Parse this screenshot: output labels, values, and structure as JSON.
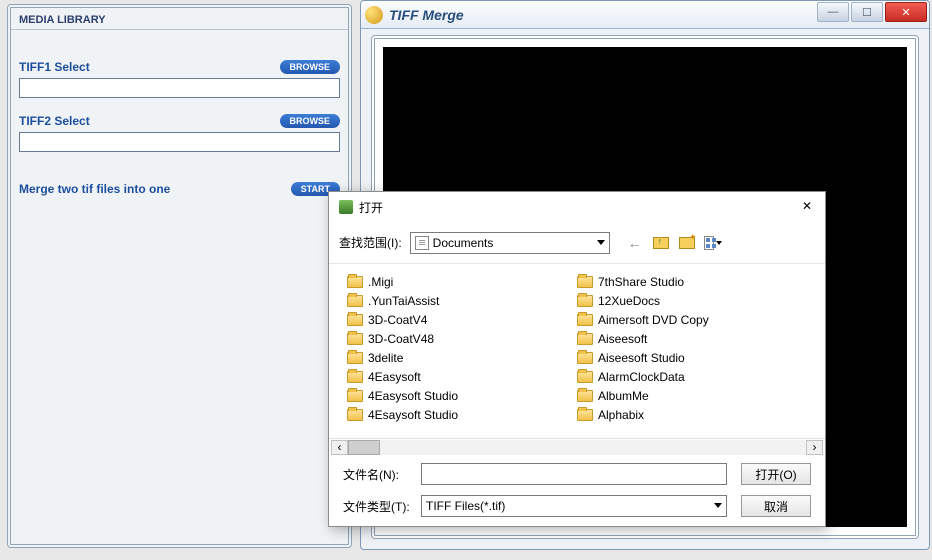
{
  "left": {
    "header": "MEDIA LIBRARY",
    "tiff1_label": "TIFF1 Select",
    "tiff2_label": "TIFF2 Select",
    "browse_label": "BROWSE",
    "merge_label": "Merge two tif files into one",
    "start_label": "START",
    "tiff1_value": "",
    "tiff2_value": ""
  },
  "right": {
    "title": "TIFF Merge"
  },
  "dialog": {
    "title": "打开",
    "lookin_label": "查找范围(I):",
    "lookin_value": "Documents",
    "filename_label": "文件名(N):",
    "filename_value": "",
    "filetype_label": "文件类型(T):",
    "filetype_value": "TIFF Files(*.tif)",
    "open_btn": "打开(O)",
    "cancel_btn": "取消",
    "items_col1": [
      ".Migi",
      ".YunTaiAssist",
      "3D-CoatV4",
      "3D-CoatV48",
      "3delite",
      "4Easysoft",
      "4Easysoft Studio",
      "4Esaysoft Studio"
    ],
    "items_col2": [
      "7thShare Studio",
      "12XueDocs",
      "Aimersoft DVD Copy",
      "Aiseesoft",
      "Aiseesoft Studio",
      "AlarmClockData",
      "AlbumMe",
      "Alphabix"
    ]
  }
}
